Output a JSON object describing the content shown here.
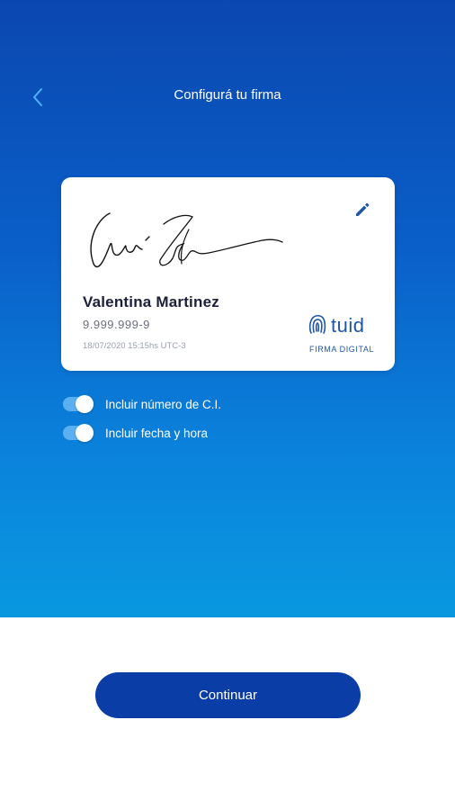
{
  "header": {
    "title": "Configurá tu firma",
    "back_icon": "chevron-left-icon"
  },
  "card": {
    "name": "Valentina Martinez",
    "ci": "9.999.999-9",
    "datetime": "18/07/2020 15:15hs UTC-3",
    "edit_icon": "pencil-icon",
    "brand": {
      "word": "tuid",
      "subtitle": "FIRMA DIGITAL"
    }
  },
  "options": [
    {
      "label": "Incluir número de C.I.",
      "enabled": true
    },
    {
      "label": "Incluir fecha y hora",
      "enabled": true
    }
  ],
  "footer": {
    "continue_label": "Continuar"
  },
  "colors": {
    "gradient_top": "#0b47b0",
    "gradient_bottom": "#0998e0",
    "button": "#0a3da6",
    "brand": "#1f56a8",
    "toggle_track": "#5ab0f0"
  }
}
